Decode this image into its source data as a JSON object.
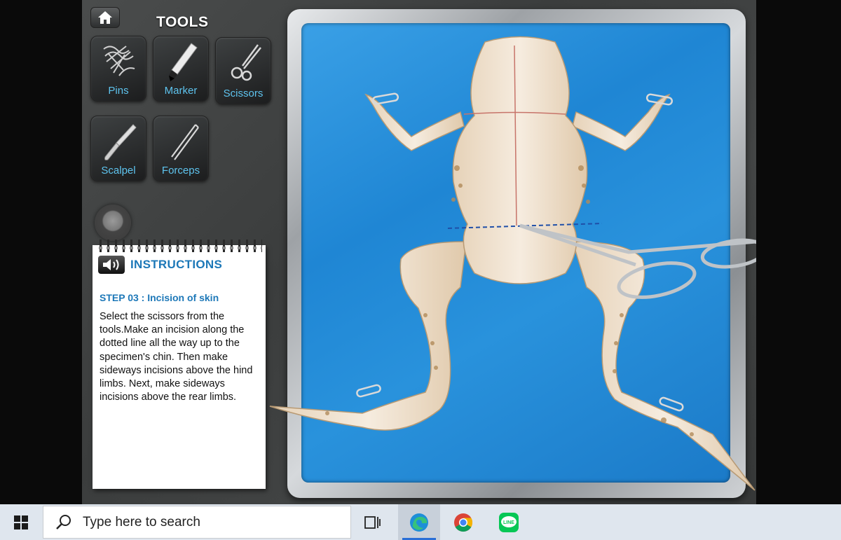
{
  "tools_panel": {
    "title": "TOOLS",
    "tools": [
      {
        "label": "Pins",
        "icon": "pins-icon"
      },
      {
        "label": "Marker",
        "icon": "marker-icon"
      },
      {
        "label": "Scissors",
        "icon": "scissors-icon"
      },
      {
        "label": "Scalpel",
        "icon": "scalpel-icon"
      },
      {
        "label": "Forceps",
        "icon": "forceps-icon"
      }
    ]
  },
  "instructions": {
    "title": "INSTRUCTIONS",
    "step_title": "STEP 03 : Incision of skin",
    "text": "Select the scissors from the tools.Make an incision along the dotted line all the way up to the specimen's chin. Then make sideways incisions above the hind limbs. Next, make sideways incisions above the rear limbs."
  },
  "taskbar": {
    "search_placeholder": "Type here to search",
    "apps": [
      {
        "name": "task-view",
        "icon": "task-view-icon"
      },
      {
        "name": "edge",
        "icon": "edge-icon",
        "active": true
      },
      {
        "name": "chrome",
        "icon": "chrome-icon"
      },
      {
        "name": "line",
        "icon": "line-icon",
        "label": "LINE"
      }
    ]
  },
  "colors": {
    "tool_label": "#5ec4ef",
    "instruction_heading": "#1d78b8",
    "tray_blue": "#2992dc",
    "incision_line": "#c7746a"
  }
}
